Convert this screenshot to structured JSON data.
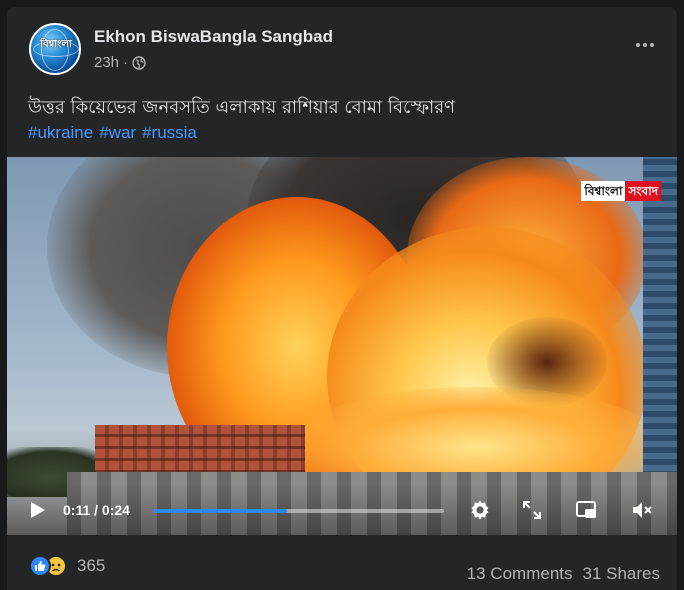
{
  "post": {
    "page_name": "Ekhon BiswaBangla Sangbad",
    "time": "23h",
    "privacy_icon": "globe-icon",
    "avatar_text": "বিশ্বাংলা",
    "text": "উত্তর কিয়েভের জনবসতি এলাকায় রাশিয়ার বোমা বিস্ফোরণ",
    "hashtags": [
      "#ukraine",
      "#war",
      "#russia"
    ]
  },
  "video": {
    "watermark_left": "বিশ্বাংলা",
    "watermark_right": "সংবাদ",
    "time_display": "0:11 / 0:24",
    "progress": 0.458,
    "accent_color": "#2d88ff",
    "icons": [
      "play-icon",
      "settings-icon",
      "fullscreen-icon",
      "picture-in-picture-icon",
      "volume-muted-icon"
    ]
  },
  "footer": {
    "reaction_icons": [
      "like-icon",
      "sad-icon"
    ],
    "reaction_count": "365",
    "comments": "13 Comments",
    "shares": "31 Shares"
  }
}
